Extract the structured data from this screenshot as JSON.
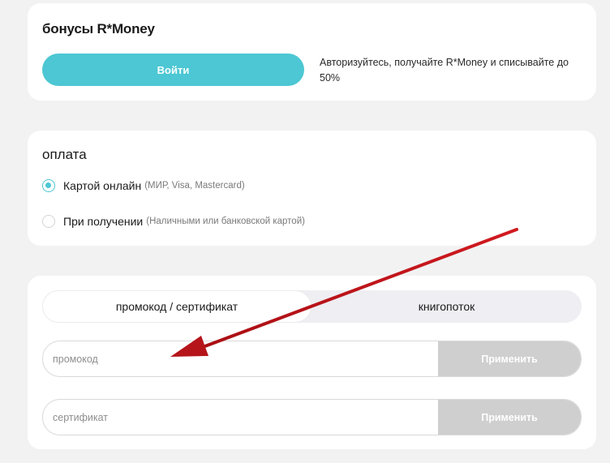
{
  "bonus": {
    "title": "бонусы R*Money",
    "login_label": "Войти",
    "description": "Авторизуйтесь, получайте R*Money и списывайте до 50%"
  },
  "payment": {
    "title": "оплата",
    "options": [
      {
        "label": "Картой онлайн",
        "hint": "(МИР, Visa, Mastercard)",
        "selected": true
      },
      {
        "label": "При получении",
        "hint": "(Наличными или банковской картой)",
        "selected": false
      }
    ]
  },
  "promo": {
    "tabs": [
      {
        "label": "промокод / сертификат",
        "active": true
      },
      {
        "label": "книгопоток",
        "active": false
      }
    ],
    "promo_field": {
      "placeholder": "промокод",
      "value": "",
      "button_label": "Применить"
    },
    "certificate_field": {
      "placeholder": "сертификат",
      "value": "",
      "button_label": "Применить"
    }
  },
  "colors": {
    "accent": "#4cc7d3",
    "apply_disabled": "#cfcfcf",
    "annotation_arrow": "#c0161c",
    "page_bg": "#f2f2f2"
  }
}
